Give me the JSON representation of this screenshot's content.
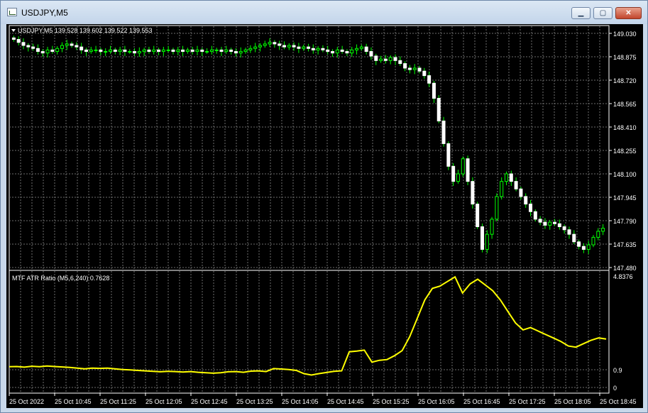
{
  "window": {
    "title": "USDJPY,M5",
    "minimize_glyph": "▁",
    "maximize_glyph": "▢",
    "close_glyph": "✕"
  },
  "colors": {
    "background": "#000000",
    "grid": "#6e6e6e",
    "bull_candle": "#00ff00",
    "bear_candle": "#ffffff",
    "indicator_line": "#ffff00",
    "text": "#ffffff"
  },
  "chart_data": [
    {
      "type": "candlestick",
      "title": "USDJPY,M5  139.528 139.602 139.522 139.553",
      "y_ticks": [
        "149.030",
        "148.875",
        "148.720",
        "148.565",
        "148.410",
        "148.255",
        "148.100",
        "147.945",
        "147.790",
        "147.635",
        "147.480"
      ],
      "ylim": [
        147.48,
        149.03
      ],
      "grid": true,
      "close_series": [
        148.99,
        148.97,
        148.95,
        148.94,
        148.93,
        148.91,
        148.9,
        148.92,
        148.91,
        148.93,
        148.95,
        148.96,
        148.95,
        148.94,
        148.92,
        148.91,
        148.92,
        148.92,
        148.91,
        148.91,
        148.92,
        148.91,
        148.92,
        148.91,
        148.91,
        148.9,
        148.91,
        148.92,
        148.91,
        148.92,
        148.91,
        148.92,
        148.92,
        148.91,
        148.92,
        148.91,
        148.92,
        148.91,
        148.92,
        148.91,
        148.91,
        148.92,
        148.92,
        148.91,
        148.92,
        148.91,
        148.9,
        148.91,
        148.92,
        148.93,
        148.94,
        148.95,
        148.96,
        148.97,
        148.96,
        148.95,
        148.94,
        148.95,
        148.94,
        148.93,
        148.94,
        148.93,
        148.92,
        148.93,
        148.92,
        148.91,
        148.9,
        148.92,
        148.91,
        148.9,
        148.92,
        148.93,
        148.94,
        148.91,
        148.88,
        148.85,
        148.86,
        148.85,
        148.87,
        148.85,
        148.83,
        148.8,
        148.79,
        148.8,
        148.78,
        148.75,
        148.7,
        148.6,
        148.45,
        148.3,
        148.15,
        148.05,
        148.1,
        148.2,
        148.05,
        147.9,
        147.75,
        147.6,
        147.7,
        147.8,
        147.95,
        148.05,
        148.1,
        148.05,
        148.0,
        147.95,
        147.9,
        147.85,
        147.8,
        147.78,
        147.76,
        147.78,
        147.77,
        147.75,
        147.73,
        147.7,
        147.65,
        147.62,
        147.6,
        147.63,
        147.68,
        147.72,
        147.74
      ]
    },
    {
      "type": "line",
      "title": "MTF ATR Ratio  (M5,6,240) 0.7628",
      "y_ticks": [
        "4.8376",
        "0.9",
        "0"
      ],
      "ylim": [
        0,
        4.8376
      ],
      "grid": true,
      "series": [
        {
          "values": [
            0.9,
            0.91,
            0.88,
            0.92,
            0.9,
            0.93,
            0.91,
            0.89,
            0.87,
            0.84,
            0.81,
            0.84,
            0.83,
            0.84,
            0.81,
            0.78,
            0.76,
            0.74,
            0.72,
            0.7,
            0.68,
            0.7,
            0.69,
            0.67,
            0.69,
            0.66,
            0.64,
            0.62,
            0.64,
            0.68,
            0.69,
            0.66,
            0.71,
            0.72,
            0.69,
            0.82,
            0.8,
            0.78,
            0.74,
            0.6,
            0.54,
            0.6,
            0.65,
            0.7,
            0.72,
            1.55,
            1.58,
            1.62,
            1.1,
            1.18,
            1.21,
            1.38,
            1.6,
            2.2,
            3.0,
            3.8,
            4.3,
            4.4,
            4.6,
            4.8,
            4.1,
            4.5,
            4.7,
            4.45,
            4.2,
            3.8,
            3.3,
            2.8,
            2.5,
            2.6,
            2.45,
            2.3,
            2.15,
            2.0,
            1.8,
            1.75,
            1.9,
            2.05,
            2.15,
            2.1
          ]
        }
      ]
    }
  ],
  "x_axis_labels": [
    "25 Oct 2022",
    "25 Oct 10:45",
    "25 Oct 11:25",
    "25 Oct 12:05",
    "25 Oct 12:45",
    "25 Oct 13:25",
    "25 Oct 14:05",
    "25 Oct 14:45",
    "25 Oct 15:25",
    "25 Oct 16:05",
    "25 Oct 16:45",
    "25 Oct 17:25",
    "25 Oct 18:05",
    "25 Oct 18:45"
  ]
}
